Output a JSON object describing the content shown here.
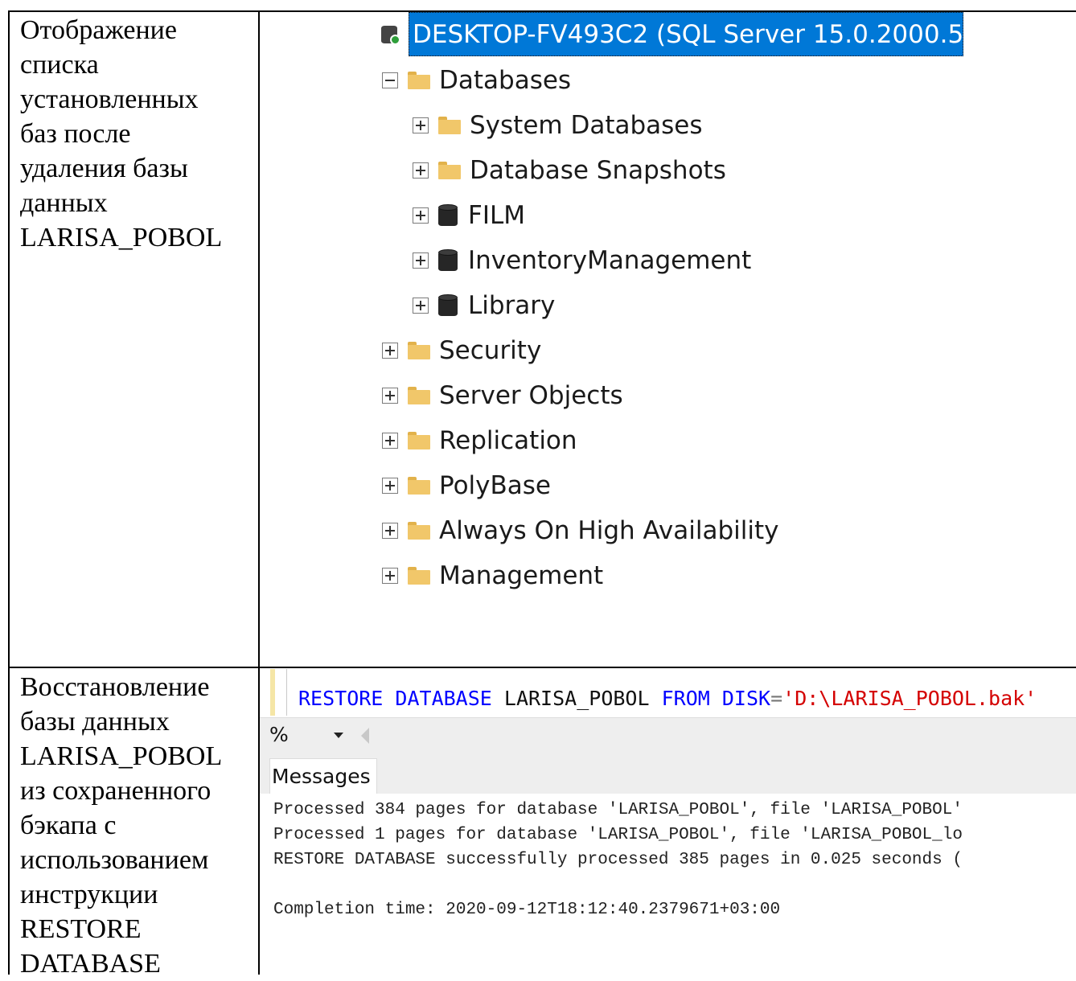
{
  "table": {
    "row1_desc": [
      "Отображение",
      "списка",
      "установленных",
      "баз после",
      "удаления базы",
      "данных",
      "LARISA_POBOL"
    ],
    "row2_desc": [
      "Восстановление",
      "базы данных",
      "LARISA_POBOL",
      "из сохраненного",
      "бэкапа с",
      "использованием",
      "инструкции",
      "RESTORE",
      "DATABASE"
    ]
  },
  "object_explorer": {
    "server": "DESKTOP-FV493C2 (SQL Server 15.0.2000.5",
    "items": [
      {
        "label": "Databases",
        "expander": "minus",
        "icon": "folder-icon"
      },
      {
        "label": "System Databases",
        "expander": "plus",
        "icon": "folder-icon"
      },
      {
        "label": "Database Snapshots",
        "expander": "plus",
        "icon": "folder-icon"
      },
      {
        "label": "FILM",
        "expander": "plus",
        "icon": "database-icon"
      },
      {
        "label": "InventoryManagement",
        "expander": "plus",
        "icon": "database-icon"
      },
      {
        "label": "Library",
        "expander": "plus",
        "icon": "database-icon"
      },
      {
        "label": "Security",
        "expander": "plus",
        "icon": "folder-icon"
      },
      {
        "label": "Server Objects",
        "expander": "plus",
        "icon": "folder-icon"
      },
      {
        "label": "Replication",
        "expander": "plus",
        "icon": "folder-icon"
      },
      {
        "label": "PolyBase",
        "expander": "plus",
        "icon": "folder-icon"
      },
      {
        "label": "Always On High Availability",
        "expander": "plus",
        "icon": "folder-icon"
      },
      {
        "label": "Management",
        "expander": "plus",
        "icon": "folder-icon"
      }
    ]
  },
  "editor": {
    "sql": {
      "kw1": "RESTORE",
      "kw2": "DATABASE",
      "db": "LARISA_POBOL",
      "kw3": "FROM",
      "kw4": "DISK",
      "eq": "=",
      "path": "'D:\\LARISA_POBOL.bak'"
    },
    "zoom": "%",
    "tab_label": "Messages",
    "messages": [
      "Processed 384 pages for database 'LARISA_POBOL', file 'LARISA_POBOL'",
      "Processed 1 pages for database 'LARISA_POBOL', file 'LARISA_POBOL_lo",
      "RESTORE DATABASE successfully processed 385 pages in 0.025 seconds (",
      "",
      "Completion time: 2020-09-12T18:12:40.2379671+03:00"
    ]
  }
}
